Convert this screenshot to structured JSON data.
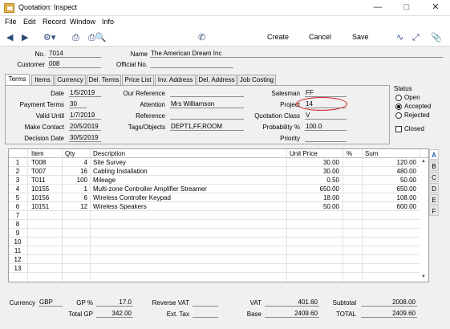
{
  "window": {
    "title": "Quotation: Inspect"
  },
  "menu": [
    "File",
    "Edit",
    "Record",
    "Window",
    "Info"
  ],
  "toolbar": {
    "create": "Create",
    "cancel": "Cancel",
    "save": "Save"
  },
  "header": {
    "no_label": "No.",
    "no": "7014",
    "name_label": "Name",
    "name": "The American Dream Inc",
    "customer_label": "Customer",
    "customer": "008",
    "official_label": "Official No.",
    "official": ""
  },
  "tabs": [
    "Terms",
    "Items",
    "Currency",
    "Del. Terms",
    "Price List",
    "Inv. Address",
    "Del. Address",
    "Job Costing"
  ],
  "terms": {
    "date_label": "Date",
    "date": "1/5/2019",
    "payment_label": "Payment Terms",
    "payment": "30",
    "valid_label": "Valid Until",
    "valid": "1/7/2019",
    "contact_label": "Make Contact",
    "contact": "20/5/2019",
    "decision_label": "Decision Date",
    "decision": "30/5/2019",
    "ourref_label": "Our Reference",
    "ourref": "",
    "attention_label": "Attention",
    "attention": "Mrs Williamson",
    "reference_label": "Reference",
    "reference": "",
    "tags_label": "Tags/Objects",
    "tags": "DEPT1,FF,ROOM",
    "salesman_label": "Salesman",
    "salesman": "FF",
    "project_label": "Project",
    "project": "14",
    "class_label": "Quotation Class",
    "class": "V",
    "probability_label": "Probability %",
    "probability": "100.0",
    "priority_label": "Priority",
    "priority": ""
  },
  "status": {
    "label": "Status",
    "open": "Open",
    "accepted": "Accepted",
    "rejected": "Rejected",
    "closed": "Closed",
    "selected": "Accepted"
  },
  "grid": {
    "columns": [
      "Item",
      "Qty",
      "Description",
      "Unit Price",
      "%",
      "Sum"
    ],
    "rows": [
      {
        "n": "1",
        "item": "T008",
        "qty": "4",
        "desc": "Site Survey",
        "price": "30.00",
        "pct": "",
        "sum": "120.00"
      },
      {
        "n": "2",
        "item": "T007",
        "qty": "16",
        "desc": "Cabling Installation",
        "price": "30.00",
        "pct": "",
        "sum": "480.00"
      },
      {
        "n": "3",
        "item": "T011",
        "qty": "100",
        "desc": "Mileage",
        "price": "0.50",
        "pct": "",
        "sum": "50.00"
      },
      {
        "n": "4",
        "item": "10155",
        "qty": "1",
        "desc": "Multi-zone Controller Amplifier Streamer",
        "price": "650.00",
        "pct": "",
        "sum": "650.00"
      },
      {
        "n": "5",
        "item": "10156",
        "qty": "6",
        "desc": "Wireless Controller Keypad",
        "price": "18.00",
        "pct": "",
        "sum": "108.00"
      },
      {
        "n": "6",
        "item": "10151",
        "qty": "12",
        "desc": "Wireless Speakers",
        "price": "50.00",
        "pct": "",
        "sum": "600.00"
      },
      {
        "n": "7",
        "item": "",
        "qty": "",
        "desc": "",
        "price": "",
        "pct": "",
        "sum": ""
      },
      {
        "n": "8",
        "item": "",
        "qty": "",
        "desc": "",
        "price": "",
        "pct": "",
        "sum": ""
      },
      {
        "n": "9",
        "item": "",
        "qty": "",
        "desc": "",
        "price": "",
        "pct": "",
        "sum": ""
      },
      {
        "n": "10",
        "item": "",
        "qty": "",
        "desc": "",
        "price": "",
        "pct": "",
        "sum": ""
      },
      {
        "n": "11",
        "item": "",
        "qty": "",
        "desc": "",
        "price": "",
        "pct": "",
        "sum": ""
      },
      {
        "n": "12",
        "item": "",
        "qty": "",
        "desc": "",
        "price": "",
        "pct": "",
        "sum": ""
      },
      {
        "n": "13",
        "item": "",
        "qty": "",
        "desc": "",
        "price": "",
        "pct": "",
        "sum": ""
      }
    ],
    "side_tabs": [
      "A",
      "B",
      "C",
      "D",
      "E",
      "F"
    ]
  },
  "footer": {
    "currency_label": "Currency",
    "currency": "GBP",
    "gp_pct_label": "GP %",
    "gp_pct": "17.0",
    "total_gp_label": "Total GP",
    "total_gp": "342.00",
    "reverse_vat_label": "Reverse VAT",
    "reverse_vat": "",
    "ext_tax_label": "Ext. Tax",
    "ext_tax": "",
    "vat_label": "VAT",
    "vat": "401.60",
    "base_label": "Base",
    "base": "2409.60",
    "subtotal_label": "Subtotal",
    "subtotal": "2008.00",
    "total_label": "TOTAL",
    "total": "2409.60"
  }
}
